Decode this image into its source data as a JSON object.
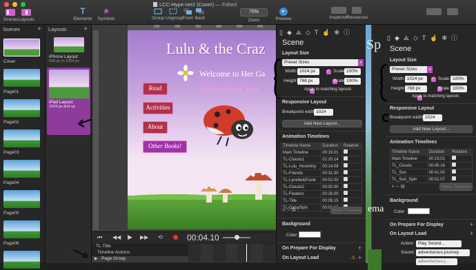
{
  "window": {
    "title": "LCC-Hype-ver2 (Cover)",
    "edited": "— Edited"
  },
  "toolbar": {
    "scenes_label": "Scenes",
    "layouts_label": "Layouts",
    "elements_label": "Elements",
    "symbols_label": "Symbols",
    "group_label": "Group",
    "ungroup_label": "Ungroup",
    "front_label": "Front",
    "back_label": "Back",
    "zoom_label": "Zoom",
    "zoom_value": "75%",
    "preview_label": "Preview",
    "inspector_label": "Inspector",
    "resources_label": "Resources",
    "font_icon_text": "T"
  },
  "scenes_panel": {
    "header": "Scenes",
    "items": [
      "Cover",
      "Page01",
      "Page02",
      "Page03",
      "Page04",
      "Page05",
      "Page06"
    ]
  },
  "layouts_panel": {
    "header": "Layouts",
    "items": [
      {
        "name": "iPhone Layout",
        "size": "568 px to 1024 px"
      },
      {
        "name": "iPad Layout",
        "size": "1024 px and up"
      }
    ]
  },
  "ruler": {
    "marks": [
      "100",
      "200",
      "300",
      "400",
      "500",
      "600",
      "700"
    ]
  },
  "stage": {
    "title": "Lulu & the Craz",
    "welcome": "Welcome to Her Ga",
    "interactive": "Interactive Rea",
    "buttons": [
      "Read",
      "Activities",
      "About",
      "Other Books!"
    ]
  },
  "timeline": {
    "current_timeline": "TL-Title",
    "time": "00:04.10",
    "rows": [
      "Timeline Actions",
      "Page Group"
    ]
  },
  "inspector": {
    "title": "Scene",
    "layout_size": {
      "heading": "Layout Size",
      "preset": "Preset Sizes",
      "width_label": "Width",
      "width_value": "1024 px",
      "height_label": "Height",
      "height_value": "768 px",
      "scale_label": "Scale",
      "scale_value": "100%",
      "apply_label": "Apply to matching layouts"
    },
    "responsive": {
      "heading": "Responsive Layout",
      "breakpoint_label": "Breakpoint width",
      "breakpoint_value": "1024 px",
      "add_button": "Add New Layout..."
    },
    "animation": {
      "heading": "Animation Timelines",
      "columns": [
        "Timeline Name",
        "Duration",
        "Relative"
      ],
      "rows": [
        [
          "Main Timeline",
          "00:19.01"
        ],
        [
          "TL-Clouds1",
          "01:20.14"
        ],
        [
          "TL-Lulu_Hovering",
          "00:14.08"
        ],
        [
          "TL-Friends",
          "00:31.00"
        ],
        [
          "TL-Lynette&Frank",
          "00:02.00"
        ],
        [
          "TL-Clouds2",
          "00:00.00"
        ],
        [
          "TL-Floaters",
          "00:26.00"
        ],
        [
          "TL-Title",
          "00:05.15"
        ],
        [
          "TL-DaisySpin",
          "00:01.15"
        ]
      ],
      "show_button": "Show Timeline"
    },
    "background": {
      "heading": "Background",
      "color_label": "Color"
    },
    "prepare": {
      "label": "On Prepare For Display"
    },
    "layout_load": {
      "label": "On Layout Load"
    }
  },
  "inspector2": {
    "title": "Scene",
    "layout_size": {
      "heading": "Layout Size",
      "preset": "Preset Sizes",
      "width_label": "Width",
      "width_value": "1024 px",
      "height_label": "Height",
      "height_value": "768 px",
      "scale_label": "Scale",
      "scale_value": "100%",
      "apply_label": "Apply to matching layouts"
    },
    "responsive": {
      "heading": "Responsive Layout",
      "breakpoint_label": "Breakpoint width",
      "breakpoint_value": "1024 px",
      "add_button": "Add New Layout..."
    },
    "animation": {
      "heading": "Animation Timelines",
      "columns": [
        "Timeline Name",
        "Duration",
        "Relative"
      ],
      "rows": [
        [
          "Main Timeline",
          "00:19.01"
        ],
        [
          "TL_Clouds",
          "00:45.16"
        ],
        [
          "TL_Sun",
          "00:41.00"
        ],
        [
          "TL_Sun_Spin",
          "00:01.07"
        ]
      ],
      "show_button": "Show Timeline"
    },
    "background": {
      "heading": "Background",
      "color_label": "Color"
    },
    "prepare": {
      "label": "On Prepare For Display"
    },
    "layout_load": {
      "label": "On Layout Load",
      "action_label": "Action",
      "action_value": "Play Sound...",
      "sound_label": "Sound",
      "sound_value": "adventurous-journey",
      "sound_value2": "adventurous-j..."
    },
    "scene_letters": "Sp",
    "scene_letters2": "ema"
  },
  "colors": {
    "accent": "#d55fd0",
    "menu_button": "#b1304a",
    "title_pink": "#ff9ecb"
  }
}
